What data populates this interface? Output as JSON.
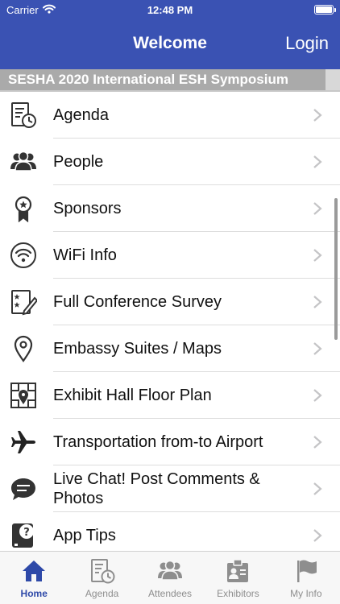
{
  "status": {
    "carrier": "Carrier",
    "time": "12:48 PM"
  },
  "nav": {
    "title": "Welcome",
    "login_label": "Login"
  },
  "banner": "SESHA 2020 International ESH Symposium",
  "menu": [
    {
      "label": "Agenda",
      "icon": "agenda-icon"
    },
    {
      "label": "People",
      "icon": "people-icon"
    },
    {
      "label": "Sponsors",
      "icon": "ribbon-icon"
    },
    {
      "label": "WiFi Info",
      "icon": "wifi-icon"
    },
    {
      "label": "Full Conference Survey",
      "icon": "survey-icon"
    },
    {
      "label": "Embassy Suites / Maps",
      "icon": "map-pin-icon"
    },
    {
      "label": "Exhibit Hall Floor Plan",
      "icon": "floor-plan-icon"
    },
    {
      "label": "Transportation from-to Airport",
      "icon": "airplane-icon"
    },
    {
      "label": "Live Chat! Post Comments & Photos",
      "icon": "chat-bubble-icon"
    },
    {
      "label": "App Tips",
      "icon": "tips-icon"
    }
  ],
  "tabs": [
    {
      "label": "Home",
      "icon": "home-icon",
      "active": true
    },
    {
      "label": "Agenda",
      "icon": "agenda-icon",
      "active": false
    },
    {
      "label": "Attendees",
      "icon": "attendees-icon",
      "active": false
    },
    {
      "label": "Exhibitors",
      "icon": "exhibitors-icon",
      "active": false
    },
    {
      "label": "My Info",
      "icon": "flag-icon",
      "active": false
    }
  ],
  "colors": {
    "header": "#3a52b3",
    "tab_active": "#2e49a8",
    "tab_inactive": "#8e8e8e",
    "banner": "#aaaaaa"
  }
}
